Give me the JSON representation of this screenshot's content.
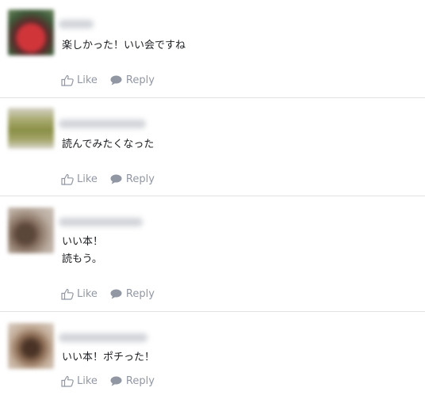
{
  "colors": {
    "action_text": "#9197a3",
    "divider": "#e1e2e4",
    "comment_text": "#1c1e21"
  },
  "actions": {
    "like_label": "Like",
    "reply_label": "Reply",
    "like_icon": "thumbs-up-icon",
    "reply_icon": "speech-bubble-icon"
  },
  "comments": [
    {
      "lines": [
        "楽しかった！いい会ですね"
      ]
    },
    {
      "lines": [
        "読んでみたくなった"
      ]
    },
    {
      "lines": [
        "いい本！",
        "読もう。"
      ]
    },
    {
      "lines": [
        "いい本！ポチった！"
      ]
    }
  ]
}
